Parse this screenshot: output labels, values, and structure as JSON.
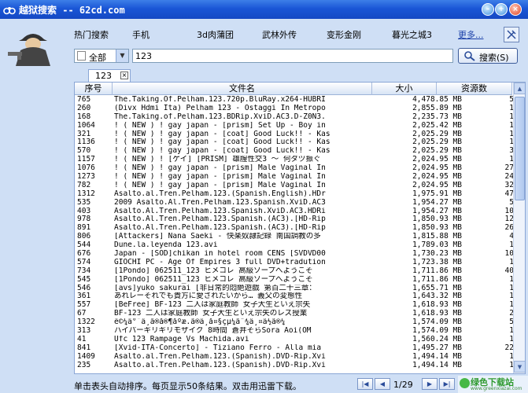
{
  "window": {
    "title": "越狱搜索 -- 62cd.com"
  },
  "nav": {
    "items": [
      "热门搜索",
      "手机",
      "3d肉蒲团",
      "武林外传",
      "变形金刚",
      "暮光之城3"
    ],
    "more": "更多..."
  },
  "search": {
    "category": "全部",
    "query": "123",
    "button_label": "搜索(S)"
  },
  "tab": {
    "label": "123"
  },
  "table": {
    "columns": [
      "序号",
      "文件名",
      "大小",
      "资源数"
    ],
    "rows": [
      {
        "id": "765",
        "name": "The.Taking.Of.Pelham.123.720p.BluRay.x264-HUBRI",
        "size": "4,478.85 MB",
        "src": "5"
      },
      {
        "id": "260",
        "name": "(Divx Hdmi Ita) Pelham 123 - Ostaggi In Metropo",
        "size": "2,855.89 MB",
        "src": "1"
      },
      {
        "id": "168",
        "name": "The.Taking.of.Pelham.123.BDRip.XviD.AC3.D-Z0N3.",
        "size": "2,235.73 MB",
        "src": "1"
      },
      {
        "id": "1064",
        "name": "! ( NEW ) ! gay japan - [prism] Set Up - Boy in",
        "size": "2,025.42 MB",
        "src": "1"
      },
      {
        "id": "321",
        "name": "! ( NEW ) ! gay japan - [coat] Good Luck!! - Kas",
        "size": "2,025.29 MB",
        "src": "1"
      },
      {
        "id": "1136",
        "name": "! ( NEW ) ! gay japan - [coat] Good Luck!! - Kas",
        "size": "2,025.29 MB",
        "src": "1"
      },
      {
        "id": "570",
        "name": "! ( NEW ) ! gay japan - [coat] Good Luck!! - Kas",
        "size": "2,025.29 MB",
        "src": "3"
      },
      {
        "id": "1157",
        "name": "! ( NEW ) ! [ゲイ] [PRISM] 雄膣性交3 ～ 何ダヅ振ぐ",
        "size": "2,024.95 MB",
        "src": "1"
      },
      {
        "id": "1076",
        "name": "! ( NEW ) ! gay japan - [prism] Male Vaginal In",
        "size": "2,024.95 MB",
        "src": "27"
      },
      {
        "id": "1273",
        "name": "! ( NEW ) ! gay japan - [prism] Male Vaginal In",
        "size": "2,024.95 MB",
        "src": "24"
      },
      {
        "id": "782",
        "name": "! ( NEW ) ! gay japan - [prism] Male Vaginal In",
        "size": "2,024.95 MB",
        "src": "32"
      },
      {
        "id": "1312",
        "name": "Asalto.al.Tren.Pelham.123.(Spanish.English).HDr",
        "size": "1,975.91 MB",
        "src": "47"
      },
      {
        "id": "535",
        "name": "2009 Asalto.Al.Tren.Pelham.123.Spanish.XviD.AC3",
        "size": "1,954.27 MB",
        "src": "5"
      },
      {
        "id": "403",
        "name": "Asalto.Al.Tren.Pelham.123.Spanish.XviD.AC3.HDRi",
        "size": "1,954.27 MB",
        "src": "10"
      },
      {
        "id": "978",
        "name": "Asalto.Al.Tren.Pelham.123.Spanish.(AC3).[HD-Rip",
        "size": "1,850.93 MB",
        "src": "12"
      },
      {
        "id": "891",
        "name": "Asalto.Al.Tren.Pelham.123.Spanish.(AC3).[HD-Rip",
        "size": "1,850.93 MB",
        "src": "26"
      },
      {
        "id": "806",
        "name": "[Attackers] Nana Saeki - 快楽奴隷記録 南国調教の多",
        "size": "1,815.88 MB",
        "src": "4"
      },
      {
        "id": "544",
        "name": "Dune.la.leyenda 123.avi",
        "size": "1,789.03 MB",
        "src": "1"
      },
      {
        "id": "676",
        "name": "Japan - [SOD]chikan in hotel room CENS [SVDVD00",
        "size": "1,730.23 MB",
        "src": "10"
      },
      {
        "id": "574",
        "name": "GIOCHI PC - Age Of Empires 3 full DVD+tradution",
        "size": "1,723.38 MB",
        "src": "1"
      },
      {
        "id": "734",
        "name": "[1Pondo] 062511_123 ヒメコレ 高級ソープへようこそ",
        "size": "1,711.86 MB",
        "src": "40"
      },
      {
        "id": "545",
        "name": "[1Pondo] 062511_123 ヒメコレ 高級ソープへようこそ",
        "size": "1,711.86 MB",
        "src": "1"
      },
      {
        "id": "546",
        "name": "[avs]yuko sakurai [非日常的悶絶遊戯 第百二十三章：",
        "size": "1,655.71 MB",
        "src": "1"
      },
      {
        "id": "361",
        "name": "あれレーそれでも貴方に愛されたいから… 義父の変態性",
        "size": "1,643.32 MB",
        "src": "1"
      },
      {
        "id": "557",
        "name": "[BeFree] BF-123 二人は家庭教師 女子大生といえ宗失",
        "size": "1,618.93 MB",
        "src": "1"
      },
      {
        "id": "67",
        "name": "BF-123 二人は家庭教師 女子大生といえ宗失のレズ授業",
        "size": "1,618.93 MB",
        "src": "2"
      },
      {
        "id": "1322",
        "name": "ê©¼ä°¯ä¸ã®å®¶åº­æ.ã®ä¸å¤§çµ¼ã¨¾ä¸¤ä½ã®¼",
        "size": "1,574.09 MB",
        "src": "5"
      },
      {
        "id": "313",
        "name": "ハイパーギリギリモザイク 8時間 蒼井そらSora Aoi(OM",
        "size": "1,574.09 MB",
        "src": "1"
      },
      {
        "id": "41",
        "name": "Ufc 123 Rampage Vs Machida.avi",
        "size": "1,560.24 MB",
        "src": "1"
      },
      {
        "id": "841",
        "name": "[Xvid-ITA-Concerto] - Tiziano Ferro - Alla mia",
        "size": "1,495.27 MB",
        "src": "22"
      },
      {
        "id": "1409",
        "name": "Asalto.al.Tren.Pelham.123.(Spanish).DVD-Rip.Xvi",
        "size": "1,494.14 MB",
        "src": "1"
      },
      {
        "id": "235",
        "name": "Asalto.al.Tren.Pelham.123.(Spanish).DVD-Rip.Xvi",
        "size": "1,494.14 MB",
        "src": "1"
      }
    ]
  },
  "status": {
    "text": "单击表头自动排序。每页显示50条结果。双击用迅雷下载。",
    "page": "1/29"
  },
  "watermark": {
    "main": "绿色下载站",
    "sub": "www.greenxiazai.com"
  },
  "colors": {
    "titlebar": "#1a56d6",
    "background": "#cfdff5",
    "link": "#1a3fa8"
  }
}
